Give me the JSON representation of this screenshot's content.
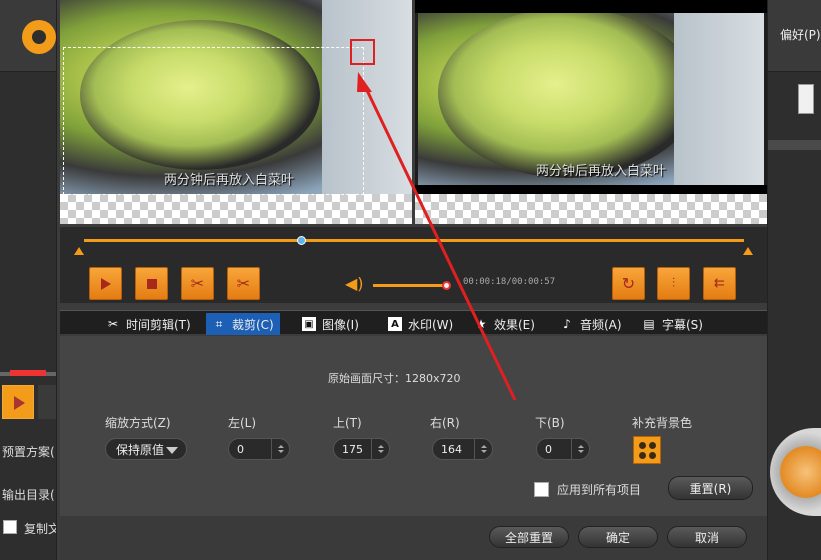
{
  "app": {
    "preferences_label": "偏好(P)",
    "preset_label": "预置方案(",
    "output_dir_label": "输出目录(",
    "copy_label": "复制文"
  },
  "preview": {
    "left_caption": "两分钟后再放入白菜叶",
    "right_caption": "两分钟后再放入白菜叶"
  },
  "player": {
    "time_display": "00:00:18/00:00:57",
    "timeline_progress": 0.33,
    "volume_level": 1.0
  },
  "tabs": [
    {
      "label": "时间剪辑(T)",
      "icon": "scissors-icon"
    },
    {
      "label": "裁剪(C)",
      "icon": "crop-icon",
      "active": true
    },
    {
      "label": "图像(I)",
      "icon": "image-icon"
    },
    {
      "label": "水印(W)",
      "icon": "watermark-icon"
    },
    {
      "label": "效果(E)",
      "icon": "star-icon"
    },
    {
      "label": "音频(A)",
      "icon": "music-note-icon"
    },
    {
      "label": "字幕(S)",
      "icon": "subtitle-icon"
    }
  ],
  "crop": {
    "original_size_label": "原始画面尺寸：1280x720",
    "zoom_mode_label": "缩放方式(Z)",
    "zoom_mode_value": "保持原值",
    "left_label": "左(L)",
    "left_value": "0",
    "top_label": "上(T)",
    "top_value": "175",
    "right_label": "右(R)",
    "right_value": "164",
    "bottom_label": "下(B)",
    "bottom_value": "0",
    "fill_bg_label": "补充背景色",
    "apply_all_label": "应用到所有项目",
    "reset_label": "重置(R)"
  },
  "footer": {
    "reset_all_label": "全部重置",
    "ok_label": "确定",
    "cancel_label": "取消"
  },
  "colors": {
    "accent": "#f29c1a",
    "active_tab": "#1c5fb4",
    "annotation": "#e02020"
  }
}
